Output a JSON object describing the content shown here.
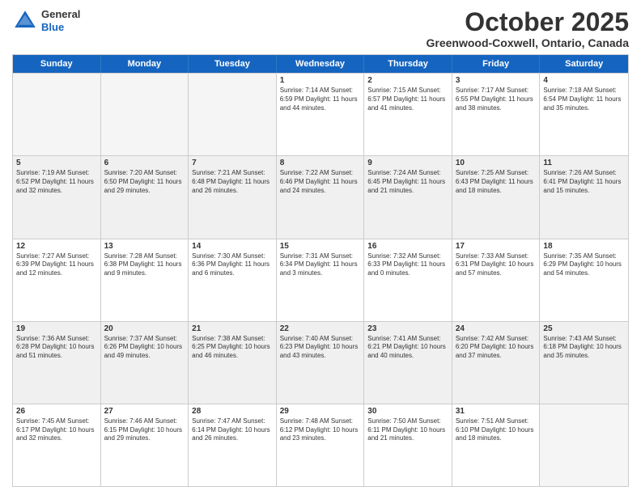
{
  "header": {
    "logo": {
      "general": "General",
      "blue": "Blue"
    },
    "title": "October 2025",
    "location": "Greenwood-Coxwell, Ontario, Canada"
  },
  "weekdays": [
    "Sunday",
    "Monday",
    "Tuesday",
    "Wednesday",
    "Thursday",
    "Friday",
    "Saturday"
  ],
  "weeks": [
    [
      {
        "day": "",
        "info": ""
      },
      {
        "day": "",
        "info": ""
      },
      {
        "day": "",
        "info": ""
      },
      {
        "day": "1",
        "info": "Sunrise: 7:14 AM\nSunset: 6:59 PM\nDaylight: 11 hours and 44 minutes."
      },
      {
        "day": "2",
        "info": "Sunrise: 7:15 AM\nSunset: 6:57 PM\nDaylight: 11 hours and 41 minutes."
      },
      {
        "day": "3",
        "info": "Sunrise: 7:17 AM\nSunset: 6:55 PM\nDaylight: 11 hours and 38 minutes."
      },
      {
        "day": "4",
        "info": "Sunrise: 7:18 AM\nSunset: 6:54 PM\nDaylight: 11 hours and 35 minutes."
      }
    ],
    [
      {
        "day": "5",
        "info": "Sunrise: 7:19 AM\nSunset: 6:52 PM\nDaylight: 11 hours and 32 minutes."
      },
      {
        "day": "6",
        "info": "Sunrise: 7:20 AM\nSunset: 6:50 PM\nDaylight: 11 hours and 29 minutes."
      },
      {
        "day": "7",
        "info": "Sunrise: 7:21 AM\nSunset: 6:48 PM\nDaylight: 11 hours and 26 minutes."
      },
      {
        "day": "8",
        "info": "Sunrise: 7:22 AM\nSunset: 6:46 PM\nDaylight: 11 hours and 24 minutes."
      },
      {
        "day": "9",
        "info": "Sunrise: 7:24 AM\nSunset: 6:45 PM\nDaylight: 11 hours and 21 minutes."
      },
      {
        "day": "10",
        "info": "Sunrise: 7:25 AM\nSunset: 6:43 PM\nDaylight: 11 hours and 18 minutes."
      },
      {
        "day": "11",
        "info": "Sunrise: 7:26 AM\nSunset: 6:41 PM\nDaylight: 11 hours and 15 minutes."
      }
    ],
    [
      {
        "day": "12",
        "info": "Sunrise: 7:27 AM\nSunset: 6:39 PM\nDaylight: 11 hours and 12 minutes."
      },
      {
        "day": "13",
        "info": "Sunrise: 7:28 AM\nSunset: 6:38 PM\nDaylight: 11 hours and 9 minutes."
      },
      {
        "day": "14",
        "info": "Sunrise: 7:30 AM\nSunset: 6:36 PM\nDaylight: 11 hours and 6 minutes."
      },
      {
        "day": "15",
        "info": "Sunrise: 7:31 AM\nSunset: 6:34 PM\nDaylight: 11 hours and 3 minutes."
      },
      {
        "day": "16",
        "info": "Sunrise: 7:32 AM\nSunset: 6:33 PM\nDaylight: 11 hours and 0 minutes."
      },
      {
        "day": "17",
        "info": "Sunrise: 7:33 AM\nSunset: 6:31 PM\nDaylight: 10 hours and 57 minutes."
      },
      {
        "day": "18",
        "info": "Sunrise: 7:35 AM\nSunset: 6:29 PM\nDaylight: 10 hours and 54 minutes."
      }
    ],
    [
      {
        "day": "19",
        "info": "Sunrise: 7:36 AM\nSunset: 6:28 PM\nDaylight: 10 hours and 51 minutes."
      },
      {
        "day": "20",
        "info": "Sunrise: 7:37 AM\nSunset: 6:26 PM\nDaylight: 10 hours and 49 minutes."
      },
      {
        "day": "21",
        "info": "Sunrise: 7:38 AM\nSunset: 6:25 PM\nDaylight: 10 hours and 46 minutes."
      },
      {
        "day": "22",
        "info": "Sunrise: 7:40 AM\nSunset: 6:23 PM\nDaylight: 10 hours and 43 minutes."
      },
      {
        "day": "23",
        "info": "Sunrise: 7:41 AM\nSunset: 6:21 PM\nDaylight: 10 hours and 40 minutes."
      },
      {
        "day": "24",
        "info": "Sunrise: 7:42 AM\nSunset: 6:20 PM\nDaylight: 10 hours and 37 minutes."
      },
      {
        "day": "25",
        "info": "Sunrise: 7:43 AM\nSunset: 6:18 PM\nDaylight: 10 hours and 35 minutes."
      }
    ],
    [
      {
        "day": "26",
        "info": "Sunrise: 7:45 AM\nSunset: 6:17 PM\nDaylight: 10 hours and 32 minutes."
      },
      {
        "day": "27",
        "info": "Sunrise: 7:46 AM\nSunset: 6:15 PM\nDaylight: 10 hours and 29 minutes."
      },
      {
        "day": "28",
        "info": "Sunrise: 7:47 AM\nSunset: 6:14 PM\nDaylight: 10 hours and 26 minutes."
      },
      {
        "day": "29",
        "info": "Sunrise: 7:48 AM\nSunset: 6:12 PM\nDaylight: 10 hours and 23 minutes."
      },
      {
        "day": "30",
        "info": "Sunrise: 7:50 AM\nSunset: 6:11 PM\nDaylight: 10 hours and 21 minutes."
      },
      {
        "day": "31",
        "info": "Sunrise: 7:51 AM\nSunset: 6:10 PM\nDaylight: 10 hours and 18 minutes."
      },
      {
        "day": "",
        "info": ""
      }
    ]
  ]
}
